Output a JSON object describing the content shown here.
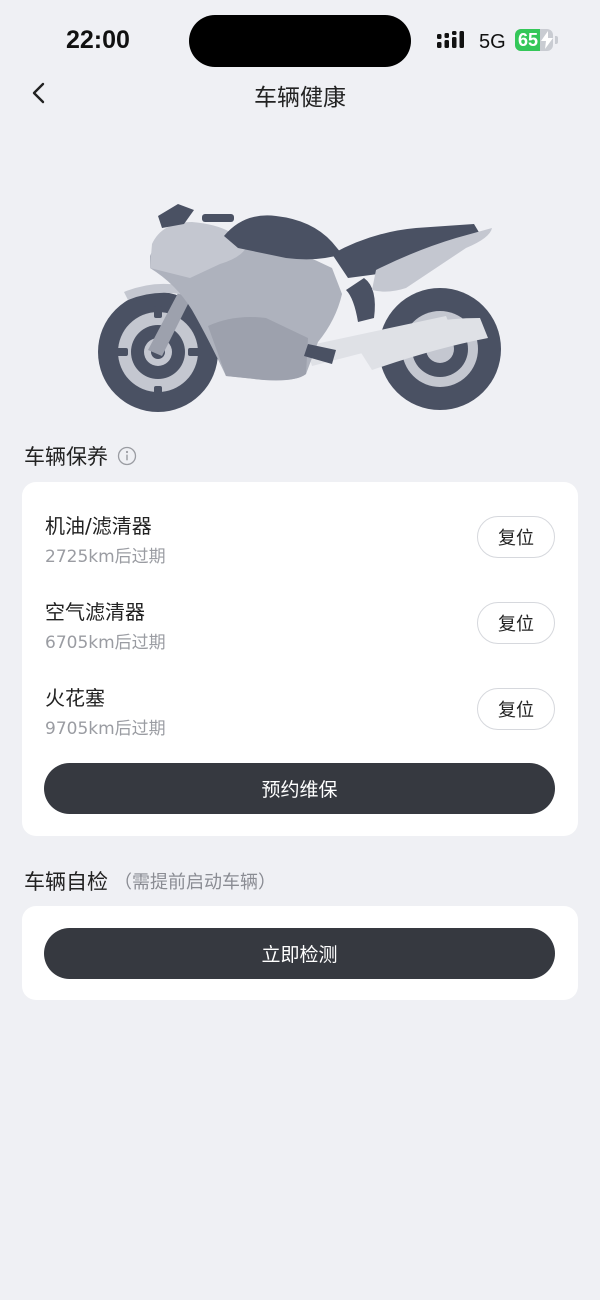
{
  "status_bar": {
    "time": "22:00",
    "network": "5G",
    "battery_percent": "65",
    "battery_level": 0.65,
    "battery_state": "charging"
  },
  "header": {
    "title": "车辆健康",
    "back_icon": "chevron-left-icon"
  },
  "vehicle": {
    "illustration": "motorcycle-illustration"
  },
  "maintenance": {
    "title": "车辆保养",
    "info_icon": "info-icon",
    "items": [
      {
        "name": "机油/滤清器",
        "status": "2725km后过期",
        "action": "复位"
      },
      {
        "name": "空气滤清器",
        "status": "6705km后过期",
        "action": "复位"
      },
      {
        "name": "火花塞",
        "status": "9705km后过期",
        "action": "复位"
      }
    ],
    "book_button": "预约维保"
  },
  "self_check": {
    "title": "车辆自检",
    "hint": "（需提前启动车辆）",
    "detect_button": "立即检测"
  },
  "colors": {
    "background": "#eff0f4",
    "card": "#ffffff",
    "primary_button": "#363940",
    "battery_green": "#34c759",
    "moto_dark": "#4a5163",
    "moto_light": "#c4c7d0"
  }
}
